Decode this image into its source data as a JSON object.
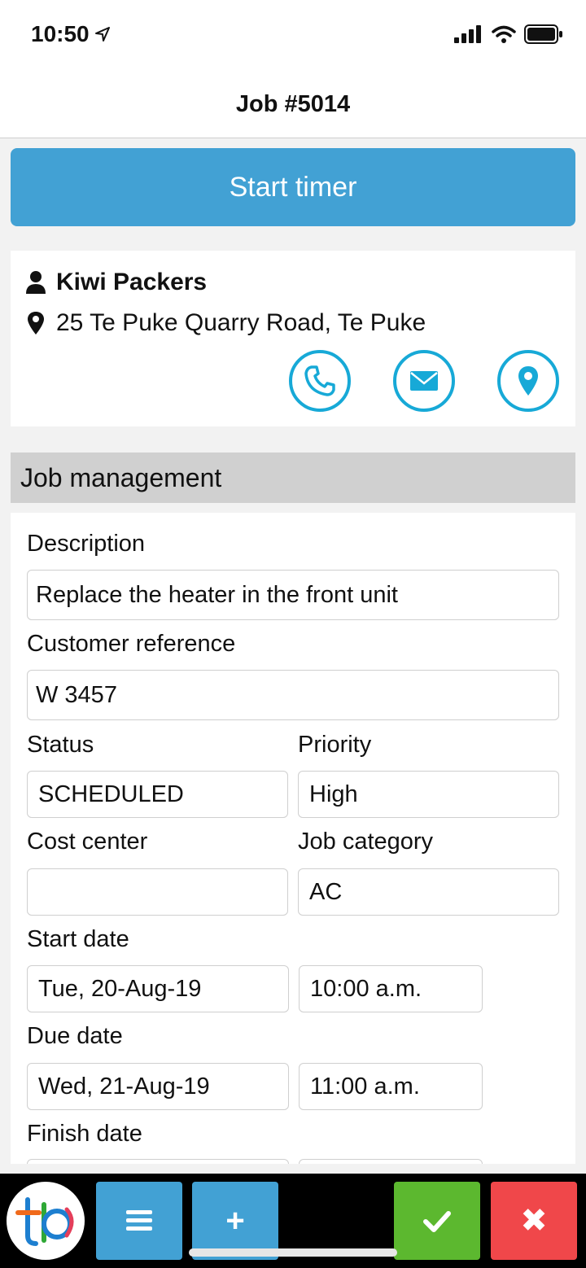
{
  "status_bar": {
    "time": "10:50"
  },
  "nav": {
    "title": "Job #5014"
  },
  "timer_button": {
    "label": "Start timer"
  },
  "customer": {
    "name": "Kiwi Packers",
    "address": "25 Te Puke Quarry Road, Te Puke",
    "actions": [
      "phone-icon",
      "email-icon",
      "map-pin-icon"
    ]
  },
  "section": {
    "title": "Job management"
  },
  "form": {
    "description_label": "Description",
    "description_value": "Replace the heater in the front unit",
    "customer_reference_label": "Customer reference",
    "customer_reference_value": "W 3457",
    "status_label": "Status",
    "status_value": "SCHEDULED",
    "priority_label": "Priority",
    "priority_value": "High",
    "cost_center_label": "Cost center",
    "cost_center_value": "",
    "job_category_label": "Job category",
    "job_category_value": "AC",
    "start_date_label": "Start date",
    "start_date_value": "Tue, 20-Aug-19",
    "start_time_value": "10:00 a.m.",
    "due_date_label": "Due date",
    "due_date_value": "Wed, 21-Aug-19",
    "due_time_value": "11:00 a.m.",
    "finish_date_label": "Finish date"
  },
  "bottom_bar": {
    "menu_icon": "hamburger-icon",
    "add_label": "+",
    "ok_icon": "checkmark-icon",
    "cancel_label": "✖"
  },
  "colors": {
    "accent_blue": "#42a1d4",
    "icon_cyan": "#17a9d7",
    "ok_green": "#5cb82f",
    "cancel_red": "#f0474a"
  }
}
